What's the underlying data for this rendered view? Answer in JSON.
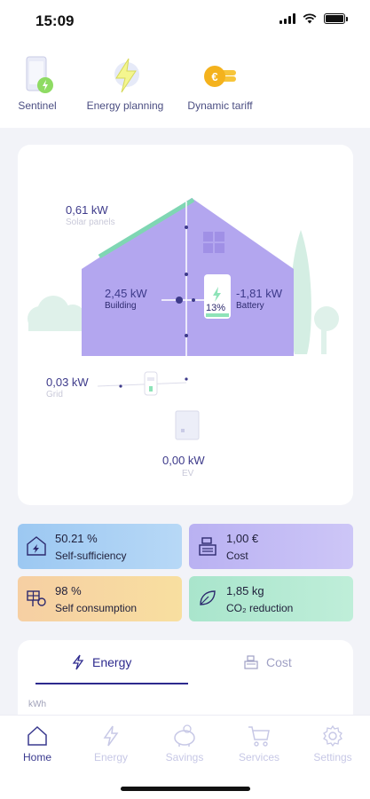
{
  "status": {
    "time": "15:09"
  },
  "quick_actions": [
    {
      "label": "Sentinel",
      "icon": "phone-charging-icon"
    },
    {
      "label": "Energy planning",
      "icon": "lightning-icon"
    },
    {
      "label": "Dynamic tariff",
      "icon": "euro-coin-icon"
    }
  ],
  "flow": {
    "solar": {
      "value": "0,61 kW",
      "label": "Solar panels"
    },
    "building": {
      "value": "2,45 kW",
      "label": "Building"
    },
    "battery": {
      "value": "-1,81 kW",
      "label": "Battery",
      "charge": "13%"
    },
    "grid": {
      "value": "0,03 kW",
      "label": "Grid"
    },
    "ev": {
      "value": "0,00 kW",
      "label": "EV"
    }
  },
  "tiles": [
    {
      "value": "50.21 %",
      "label": "Self-sufficiency",
      "icon": "solar-house-icon"
    },
    {
      "value": "1,00 €",
      "label": "Cost",
      "icon": "cash-register-icon"
    },
    {
      "value": "98 %",
      "label": "Self consumption",
      "icon": "solar-panel-icon"
    },
    {
      "value": "1,85 kg",
      "label": "CO₂ reduction",
      "icon": "leaf-icon"
    }
  ],
  "tabs": [
    {
      "label": "Energy",
      "icon": "lightning-icon",
      "active": true
    },
    {
      "label": "Cost",
      "icon": "cash-register-icon",
      "active": false
    }
  ],
  "chart": {
    "unit": "kWh"
  },
  "nav": [
    {
      "label": "Home",
      "icon": "home-icon",
      "active": true
    },
    {
      "label": "Energy",
      "icon": "lightning-icon",
      "active": false
    },
    {
      "label": "Savings",
      "icon": "piggy-bank-icon",
      "active": false
    },
    {
      "label": "Services",
      "icon": "cart-icon",
      "active": false
    },
    {
      "label": "Settings",
      "icon": "gear-icon",
      "active": false
    }
  ],
  "colors": {
    "accent": "#2d2a8e",
    "house": "#b3a6ef",
    "solar_bar": "#7fd6b3",
    "tile_blue": "#9cc8f2",
    "tile_purple": "#c3bdf6",
    "tile_orange": "#f6cfa3",
    "tile_green": "#a9e5cc"
  }
}
